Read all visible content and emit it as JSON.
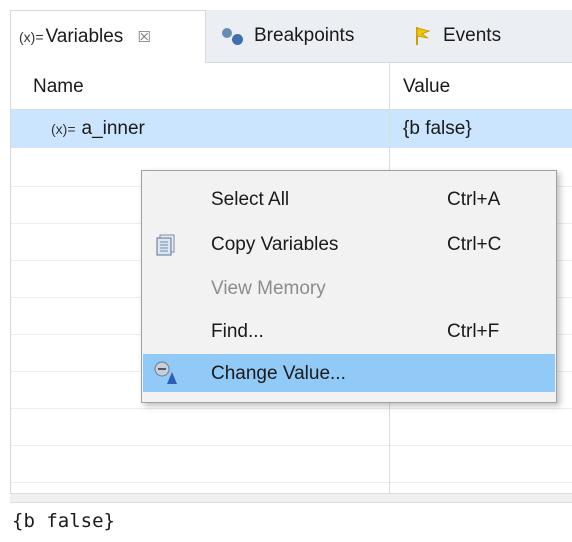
{
  "tabs": [
    {
      "prefix": "(x)=",
      "label": "Variables",
      "close": "☒",
      "active": true
    },
    {
      "label": "Breakpoints",
      "active": false
    },
    {
      "label": "Events",
      "active": false
    }
  ],
  "table": {
    "columns": [
      "Name",
      "Value"
    ],
    "rows": [
      {
        "prefix": "(x)=",
        "name": "a_inner",
        "value": "{b false}",
        "selected": true
      }
    ]
  },
  "context_menu": {
    "items": [
      {
        "label": "Select All",
        "shortcut": "Ctrl+A",
        "icon": "",
        "enabled": true,
        "highlighted": false
      },
      {
        "label": "Copy Variables",
        "shortcut": "Ctrl+C",
        "icon": "copy-icon",
        "enabled": true,
        "highlighted": false
      },
      {
        "label": "View Memory",
        "shortcut": "",
        "icon": "",
        "enabled": false,
        "highlighted": false
      },
      {
        "label": "Find...",
        "shortcut": "Ctrl+F",
        "icon": "",
        "enabled": true,
        "highlighted": false
      },
      {
        "label": "Change Value...",
        "shortcut": "",
        "icon": "change-value-icon",
        "enabled": true,
        "highlighted": true
      }
    ]
  },
  "detail": {
    "text": "{b false}"
  },
  "colors": {
    "selection": "#cce5ff",
    "menu_highlight": "#91c9f7",
    "tab_strip": "#ebeef3"
  }
}
